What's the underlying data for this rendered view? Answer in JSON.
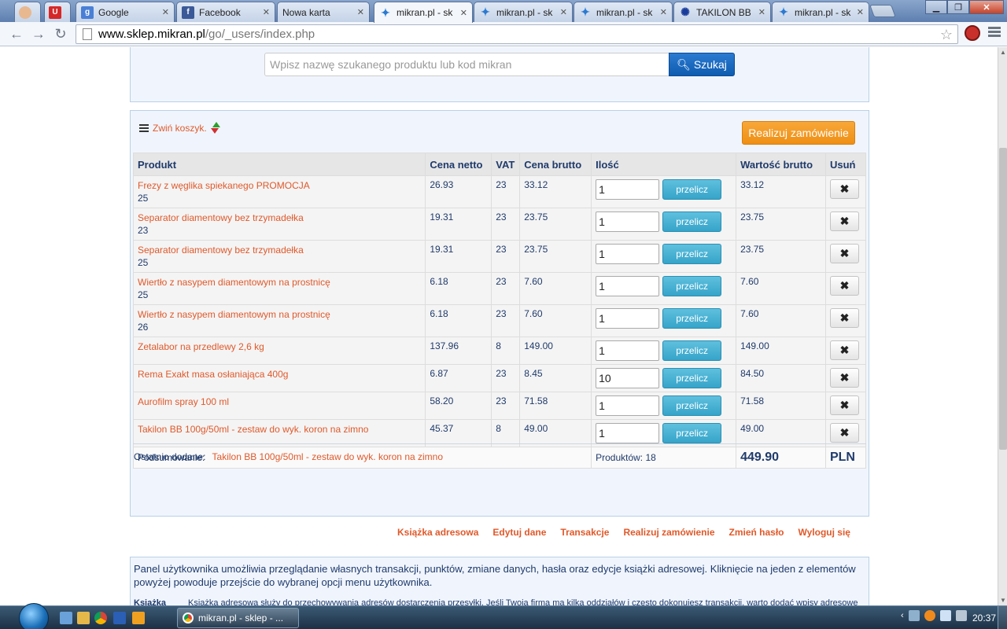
{
  "browser": {
    "tabs": [
      {
        "title": "",
        "icon": "avatar-icon",
        "left": 0
      },
      {
        "title": "",
        "icon": "u-logo-icon",
        "left": 0
      },
      {
        "title": "Google",
        "icon": "google-icon"
      },
      {
        "title": "Facebook",
        "icon": "facebook-icon"
      },
      {
        "title": "Nowa karta",
        "icon": "none"
      },
      {
        "title": "mikran.pl - sk",
        "icon": "mikran-icon"
      },
      {
        "title": "mikran.pl - sk",
        "icon": "mikran-icon"
      },
      {
        "title": "mikran.pl - sk",
        "icon": "mikran-icon"
      },
      {
        "title": "TAKILON BB",
        "icon": "takilon-icon"
      },
      {
        "title": "mikran.pl - sk",
        "icon": "mikran-icon"
      }
    ],
    "url_host": "www.sklep.mikran.pl",
    "url_path": "/go/_users/index.php"
  },
  "search": {
    "placeholder": "Wpisz nazwę szukanego produktu lub kod mikran",
    "button_label": "Szukaj"
  },
  "cart": {
    "collapse_label": "Zwiń koszyk.",
    "order_button": "Realizuj zamówienie",
    "headers": {
      "product": "Produkt",
      "net": "Cena netto",
      "vat": "VAT",
      "gross": "Cena brutto",
      "qty": "Ilość",
      "value": "Wartość brutto",
      "remove": "Usuń"
    },
    "recalc_label": "przelicz",
    "rows": [
      {
        "name": "Frezy z węglika spiekanego PROMOCJA",
        "id": "25",
        "net": "26.93",
        "vat": "23",
        "gross": "33.12",
        "qty": "1",
        "value": "33.12"
      },
      {
        "name": "Separator diamentowy bez trzymadełka",
        "id": "23",
        "net": "19.31",
        "vat": "23",
        "gross": "23.75",
        "qty": "1",
        "value": "23.75"
      },
      {
        "name": "Separator diamentowy bez trzymadełka",
        "id": "25",
        "net": "19.31",
        "vat": "23",
        "gross": "23.75",
        "qty": "1",
        "value": "23.75"
      },
      {
        "name": "Wiertło z nasypem diamentowym na prostnicę",
        "id": "25",
        "net": "6.18",
        "vat": "23",
        "gross": "7.60",
        "qty": "1",
        "value": "7.60"
      },
      {
        "name": "Wiertło z nasypem diamentowym na prostnicę",
        "id": "26",
        "net": "6.18",
        "vat": "23",
        "gross": "7.60",
        "qty": "1",
        "value": "7.60"
      },
      {
        "name": "Zetalabor na przedlewy 2,6 kg",
        "id": "",
        "net": "137.96",
        "vat": "8",
        "gross": "149.00",
        "qty": "1",
        "value": "149.00"
      },
      {
        "name": "Rema Exakt masa osłaniająca 400g",
        "id": "",
        "net": "6.87",
        "vat": "23",
        "gross": "8.45",
        "qty": "10",
        "value": "84.50"
      },
      {
        "name": "Aurofilm spray 100 ml",
        "id": "",
        "net": "58.20",
        "vat": "23",
        "gross": "71.58",
        "qty": "1",
        "value": "71.58"
      },
      {
        "name": "Takilon BB 100g/50ml - zestaw do wyk. koron na zimno",
        "id": "",
        "net": "45.37",
        "vat": "8",
        "gross": "49.00",
        "qty": "1",
        "value": "49.00"
      }
    ],
    "summary_label": "Podsumowanie:",
    "products_count": "Produktów: 18",
    "total": "449.90",
    "currency": "PLN",
    "last_added_label": "Ostatnio dodane:",
    "last_added_value": "Takilon BB 100g/50ml - zestaw do wyk. koron na zimno"
  },
  "user_menu": [
    "Książka adresowa",
    "Edytuj dane",
    "Transakcje",
    "Realizuj zamówienie",
    "Zmień hasło",
    "Wyloguj się"
  ],
  "info": {
    "text": "Panel użytkownika umożliwia przeglądanie własnych transakcji, punktów, zmiane danych, hasła oraz edycje książki adresowej. Kliknięcie na jeden z elementów powyżej powoduje przejście do wybranej opcji menu użytkownika.",
    "term": "Książka",
    "definition": "Książka adresowa służy do przechowywania adresów dostarczenia przesyłki. Jeśli Twoja firma ma kilka oddziałów i często dokonujesz transakcji, warto dodać wpisy adresowe"
  },
  "taskbar": {
    "active_task": "mikran.pl - sklep - ...",
    "clock": "20:37"
  },
  "colors": {
    "accent_orange": "#e0592a",
    "order_button": "#f39a22",
    "search_button": "#0f5cb0",
    "recalc_button": "#46b0d4",
    "total_red": "#d81313"
  }
}
